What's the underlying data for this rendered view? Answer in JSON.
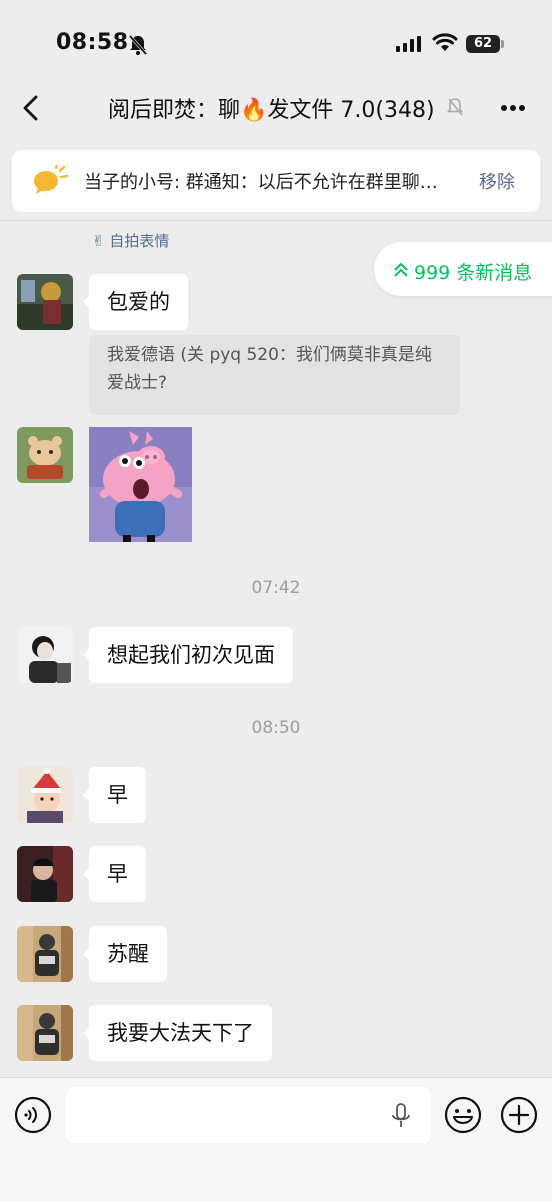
{
  "status_bar": {
    "time": "08:58",
    "battery": "62"
  },
  "header": {
    "title": "阅后即焚：聊🔥发文件 7.0(348)"
  },
  "notice": {
    "text": "当子的小号: 群通知：以后不允许在群里聊…",
    "remove_label": "移除"
  },
  "selfie_sticker_label": "自拍表情",
  "new_messages_label": "999 条新消息",
  "messages": [
    {
      "text": "包爱的"
    },
    {
      "quote": "我爱德语 (关 pyq 520：我们俩莫非真是纯爱战士?"
    },
    {
      "text": "想起我们初次见面"
    },
    {
      "text": "早"
    },
    {
      "text": "早"
    },
    {
      "text": "苏醒"
    },
    {
      "text": "我要大法天下了"
    }
  ],
  "timestamps": [
    "07:42",
    "08:50"
  ],
  "icons": {
    "back": "chevron-left-icon",
    "mute": "bell-off-icon",
    "more": "more-dots-icon",
    "voice": "voice-icon",
    "mic": "mic-icon",
    "emoji": "emoji-icon",
    "add": "plus-icon"
  },
  "colors": {
    "background": "#ededed",
    "link": "#576b95",
    "accent_green": "#07c160",
    "bubble": "#ffffff"
  }
}
